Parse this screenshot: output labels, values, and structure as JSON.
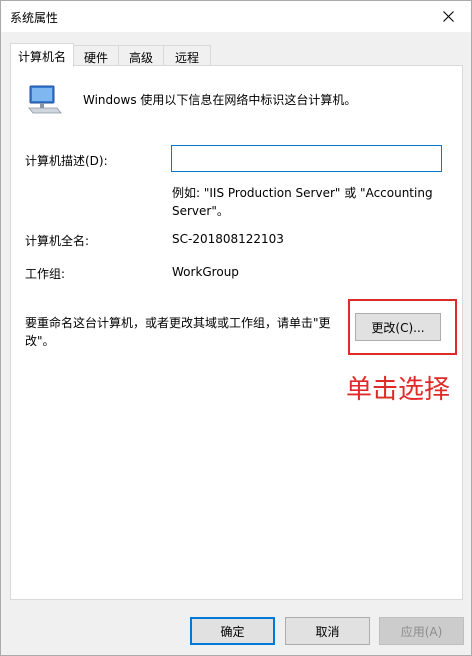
{
  "window": {
    "title": "系统属性"
  },
  "tabs": [
    {
      "label": "计算机名",
      "active": true
    },
    {
      "label": "硬件",
      "active": false
    },
    {
      "label": "高级",
      "active": false
    },
    {
      "label": "远程",
      "active": false
    }
  ],
  "computer_name_tab": {
    "intro": "Windows 使用以下信息在网络中标识这台计算机。",
    "description_label": "计算机描述(D):",
    "description_value": "",
    "example_line1": "例如: \"IIS Production Server\" 或 \"Accounting",
    "example_line2": "Server\"。",
    "full_name_label": "计算机全名:",
    "full_name_value": "SC-201808122103",
    "workgroup_label": "工作组:",
    "workgroup_value": "WorkGroup",
    "rename_text_line1": "要重命名这台计算机，或者更改其域或工作组，请单击\"更",
    "rename_text_line2": "改\"。",
    "change_button": "更改(C)..."
  },
  "annotation": {
    "text": "单击选择",
    "color": "#e02a2a"
  },
  "footer": {
    "ok": "确定",
    "cancel": "取消",
    "apply": "应用(A)"
  },
  "colors": {
    "accent": "#0078d7",
    "highlight": "#e02a2a"
  }
}
